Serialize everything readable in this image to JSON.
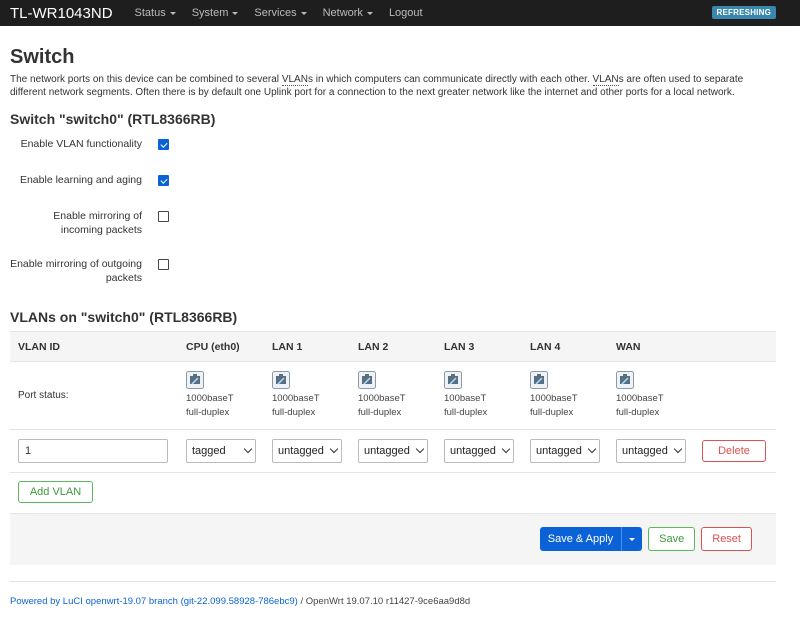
{
  "navbar": {
    "brand": "TL-WR1043ND",
    "menus": [
      "Status",
      "System",
      "Services",
      "Network"
    ],
    "logout": "Logout",
    "badge": "REFRESHING"
  },
  "page": {
    "title": "Switch",
    "description_parts": [
      "The network ports on this device can be combined to several ",
      "VLAN",
      "s in which computers can communicate directly with each other. ",
      "VLAN",
      "s are often used to separate different network segments. Often there is by default one Uplink port for a connection to the next greater network like the internet and other ports for a local network."
    ]
  },
  "switch_section": {
    "title": "Switch \"switch0\" (RTL8366RB)",
    "options": [
      {
        "label": "Enable VLAN functionality",
        "checked": true
      },
      {
        "label": "Enable learning and aging",
        "checked": true
      },
      {
        "label": "Enable mirroring of incoming packets",
        "checked": false
      },
      {
        "label": "Enable mirroring of outgoing packets",
        "checked": false
      }
    ]
  },
  "vlan_section": {
    "title": "VLANs on \"switch0\" (RTL8366RB)",
    "columns": [
      "VLAN ID",
      "CPU (eth0)",
      "LAN 1",
      "LAN 2",
      "LAN 3",
      "LAN 4",
      "WAN"
    ],
    "port_status_label": "Port status:",
    "port_status": [
      {
        "line1": "1000baseT",
        "line2": "full-duplex"
      },
      {
        "line1": "1000baseT",
        "line2": "full-duplex"
      },
      {
        "line1": "1000baseT",
        "line2": "full-duplex"
      },
      {
        "line1": "100baseT",
        "line2": "full-duplex"
      },
      {
        "line1": "1000baseT",
        "line2": "full-duplex"
      },
      {
        "line1": "1000baseT",
        "line2": "full-duplex"
      }
    ],
    "vlan_row": {
      "vlan_id": "1",
      "ports": [
        "tagged",
        "untagged",
        "untagged",
        "untagged",
        "untagged",
        "untagged"
      ],
      "delete_label": "Delete"
    },
    "add_vlan_label": "Add VLAN"
  },
  "actions": {
    "save_apply": "Save & Apply",
    "save": "Save",
    "reset": "Reset"
  },
  "footer": {
    "link_text": "Powered by LuCI openwrt-19.07 branch (git-22.099.58928-786ebc9)",
    "rest": " / OpenWrt 19.07.10 r11427-9ce6aa9d8d"
  }
}
